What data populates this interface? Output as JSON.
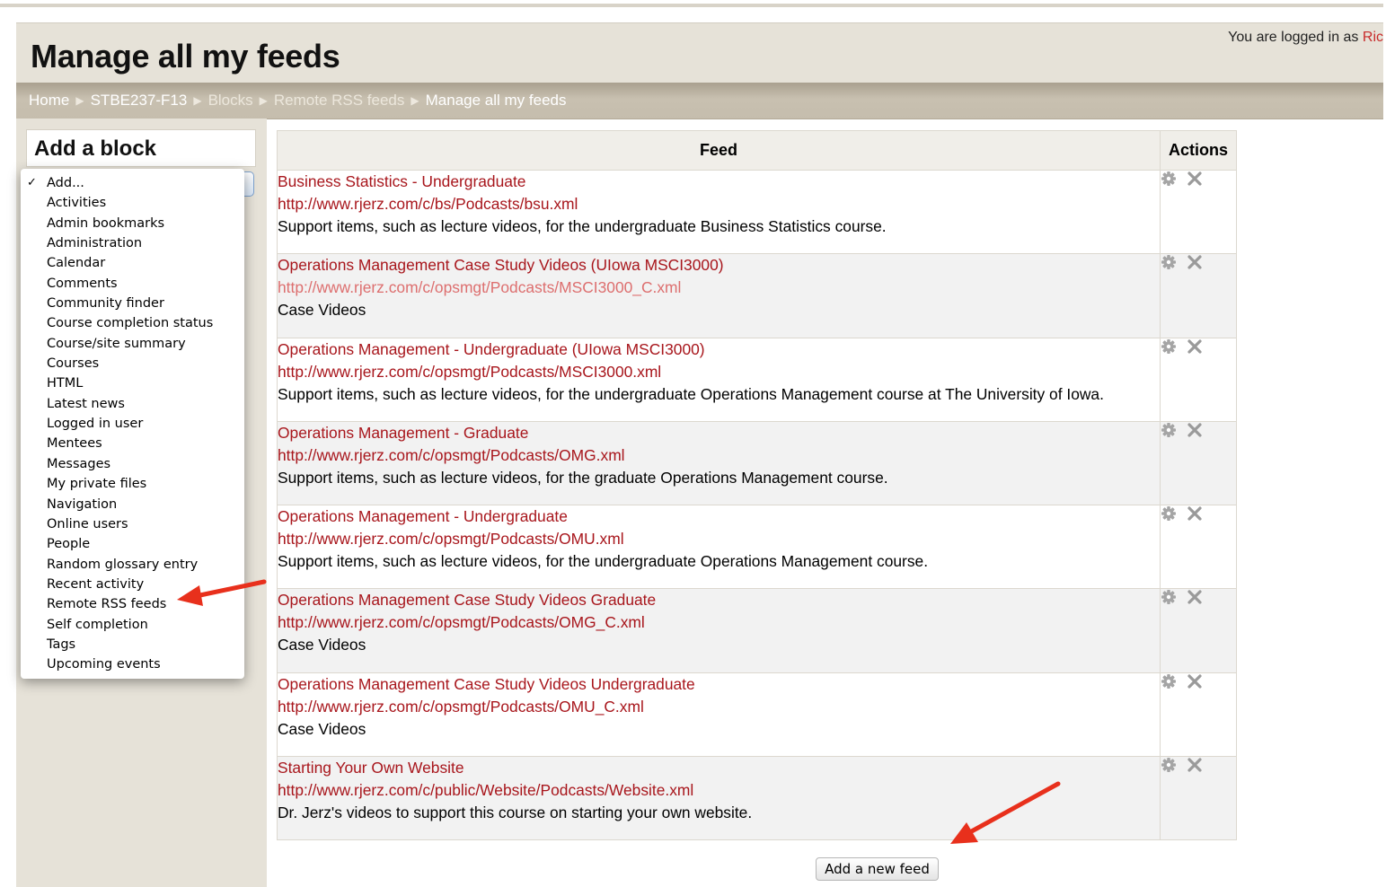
{
  "header": {
    "title": "Manage all my feeds",
    "login_prefix": "You are logged in as",
    "login_user": "Ric"
  },
  "breadcrumb": [
    "Home",
    "STBE237-F13",
    "Blocks",
    "Remote RSS feeds",
    "Manage all my feeds"
  ],
  "sidebar": {
    "block_title": "Add a block",
    "options": [
      "Add...",
      "Activities",
      "Admin bookmarks",
      "Administration",
      "Calendar",
      "Comments",
      "Community finder",
      "Course completion status",
      "Course/site summary",
      "Courses",
      "HTML",
      "Latest news",
      "Logged in user",
      "Mentees",
      "Messages",
      "My private files",
      "Navigation",
      "Online users",
      "People",
      "Random glossary entry",
      "Recent activity",
      "Remote RSS feeds",
      "Self completion",
      "Tags",
      "Upcoming events"
    ],
    "selected_option": "Add..."
  },
  "table": {
    "headers": [
      "Feed",
      "Actions"
    ],
    "rows": [
      {
        "title": "Business Statistics - Undergraduate",
        "url": "http://www.rjerz.com/c/bs/Podcasts/bsu.xml",
        "description": "Support items, such as lecture videos, for the undergraduate Business Statistics course."
      },
      {
        "title": "Operations Management Case Study Videos (UIowa MSCI3000)",
        "url": "http://www.rjerz.com/c/opsmgt/Podcasts/MSCI3000_C.xml",
        "description": "Case Videos"
      },
      {
        "title": "Operations Management - Undergraduate (UIowa MSCI3000)",
        "url": "http://www.rjerz.com/c/opsmgt/Podcasts/MSCI3000.xml",
        "description": "Support items, such as lecture videos, for the undergraduate Operations Management course at The University of Iowa."
      },
      {
        "title": "Operations Management - Graduate",
        "url": "http://www.rjerz.com/c/opsmgt/Podcasts/OMG.xml",
        "description": "Support items, such as lecture videos, for the graduate Operations Management course."
      },
      {
        "title": "Operations Management - Undergraduate",
        "url": "http://www.rjerz.com/c/opsmgt/Podcasts/OMU.xml",
        "description": "Support items, such as lecture videos, for the undergraduate Operations Management course."
      },
      {
        "title": "Operations Management Case Study Videos Graduate",
        "url": "http://www.rjerz.com/c/opsmgt/Podcasts/OMG_C.xml",
        "description": "Case Videos"
      },
      {
        "title": "Operations Management Case Study Videos Undergraduate",
        "url": "http://www.rjerz.com/c/opsmgt/Podcasts/OMU_C.xml",
        "description": "Case Videos"
      },
      {
        "title": "Starting Your Own Website",
        "url": "http://www.rjerz.com/c/public/Website/Podcasts/Website.xml",
        "description": "Dr. Jerz's videos to support this course on starting your own website."
      }
    ]
  },
  "add_feed_button": "Add a new feed",
  "icons": {
    "edit": "gear-icon",
    "delete": "close-icon",
    "annotation": "red-arrow"
  },
  "colors": {
    "link": "#a8161c",
    "visited_link": "#dd6f6f",
    "login_user": "#c82a2a",
    "arrow": "#e8301c",
    "navbar": "#c5bdad",
    "panel": "#e6e2d8"
  }
}
